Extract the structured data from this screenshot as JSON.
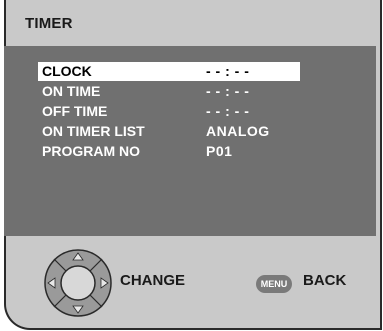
{
  "screen": {
    "title": "TIMER"
  },
  "menu": {
    "items": [
      {
        "label": "CLOCK",
        "value": "- - : - -",
        "selected": true
      },
      {
        "label": "ON TIME",
        "value": "- - : - -",
        "selected": false
      },
      {
        "label": "OFF TIME",
        "value": "- - : - -",
        "selected": false
      },
      {
        "label": "ON TIMER LIST",
        "value": "ANALOG",
        "selected": false
      },
      {
        "label": "PROGRAM NO",
        "value": "P01",
        "selected": false
      }
    ]
  },
  "footer": {
    "change_label": "CHANGE",
    "menu_key_label": "MENU",
    "back_label": "BACK",
    "dpad_icon": "dpad-icon"
  },
  "colors": {
    "frame": "#c9c9c9",
    "panel": "#707070",
    "highlight": "#ffffff"
  }
}
